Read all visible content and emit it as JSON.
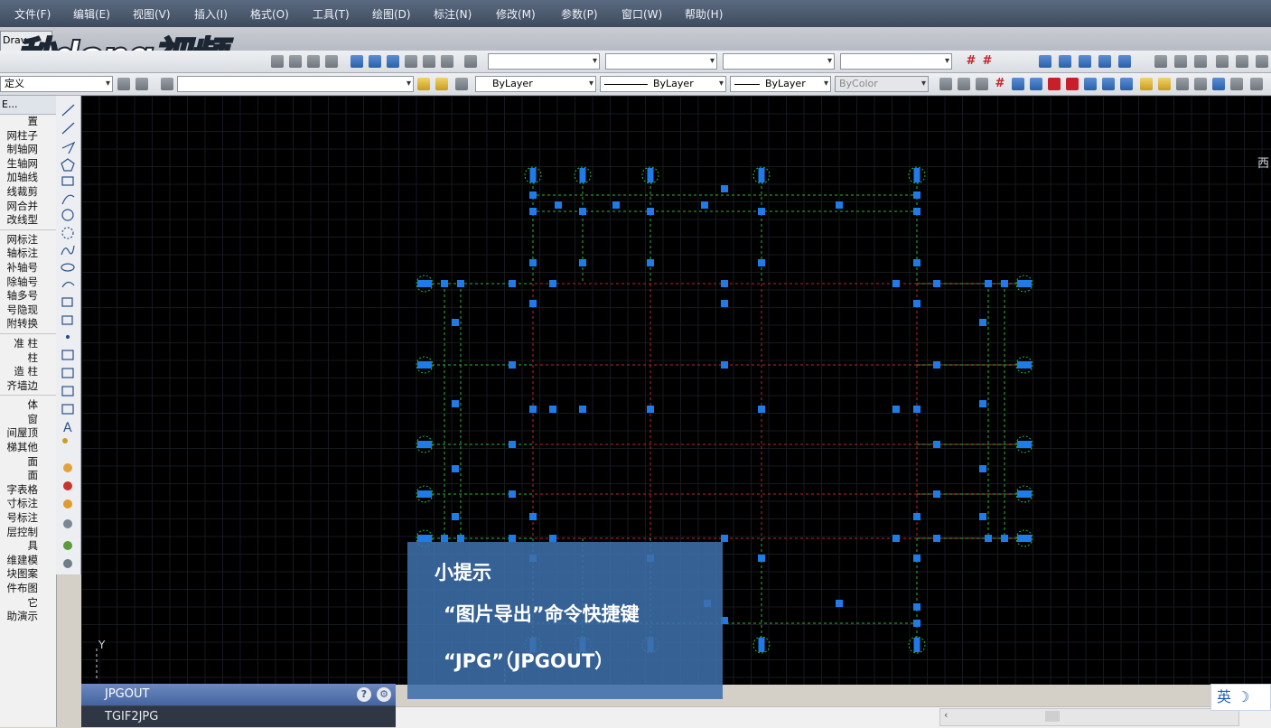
{
  "menu": [
    "文件(F)",
    "编辑(E)",
    "视图(V)",
    "插入(I)",
    "格式(O)",
    "工具(T)",
    "绘图(D)",
    "标注(N)",
    "修改(M)",
    "参数(P)",
    "窗口(W)",
    "帮助(H)"
  ],
  "tab": {
    "label": "Drav"
  },
  "watermark": {
    "text": "秒dong视频"
  },
  "toolbar2": {
    "style_combo": "定义",
    "layer_combo": "",
    "color": "ByLayer",
    "linetype": "ByLayer",
    "lineweight": "ByLayer",
    "plotstyle": "ByColor"
  },
  "leftpanel": {
    "head": "E...",
    "items": [
      "置",
      "网柱子",
      "制轴网",
      "生轴网",
      "加轴线",
      "线裁剪",
      "网合并",
      "改线型",
      "网标注",
      "轴标注",
      "补轴号",
      "除轴号",
      "轴多号",
      "号隐现",
      "附转换",
      "准 柱",
      "柱",
      "造 柱",
      "齐墙边",
      "体",
      "窗",
      "间屋顶",
      "梯其他",
      "面",
      "面",
      "字表格",
      "寸标注",
      "号标注",
      "层控制",
      "具",
      "维建模",
      "块图案",
      "件布图",
      "它",
      "助演示"
    ]
  },
  "canvas": {
    "compass_label": "西",
    "ucs_y": "Y"
  },
  "tip": {
    "title": "小提示",
    "line1": "“图片导出”命令快捷键",
    "line2": "“JPG”（JPGOUT）"
  },
  "command": {
    "line1": "JPGOUT",
    "line2": "TGIF2JPG"
  },
  "ime": {
    "label": "英"
  },
  "colors": {
    "axis_red": "#c0262d",
    "axis_green": "#2fb33a",
    "column_blue": "#1f7be8"
  }
}
